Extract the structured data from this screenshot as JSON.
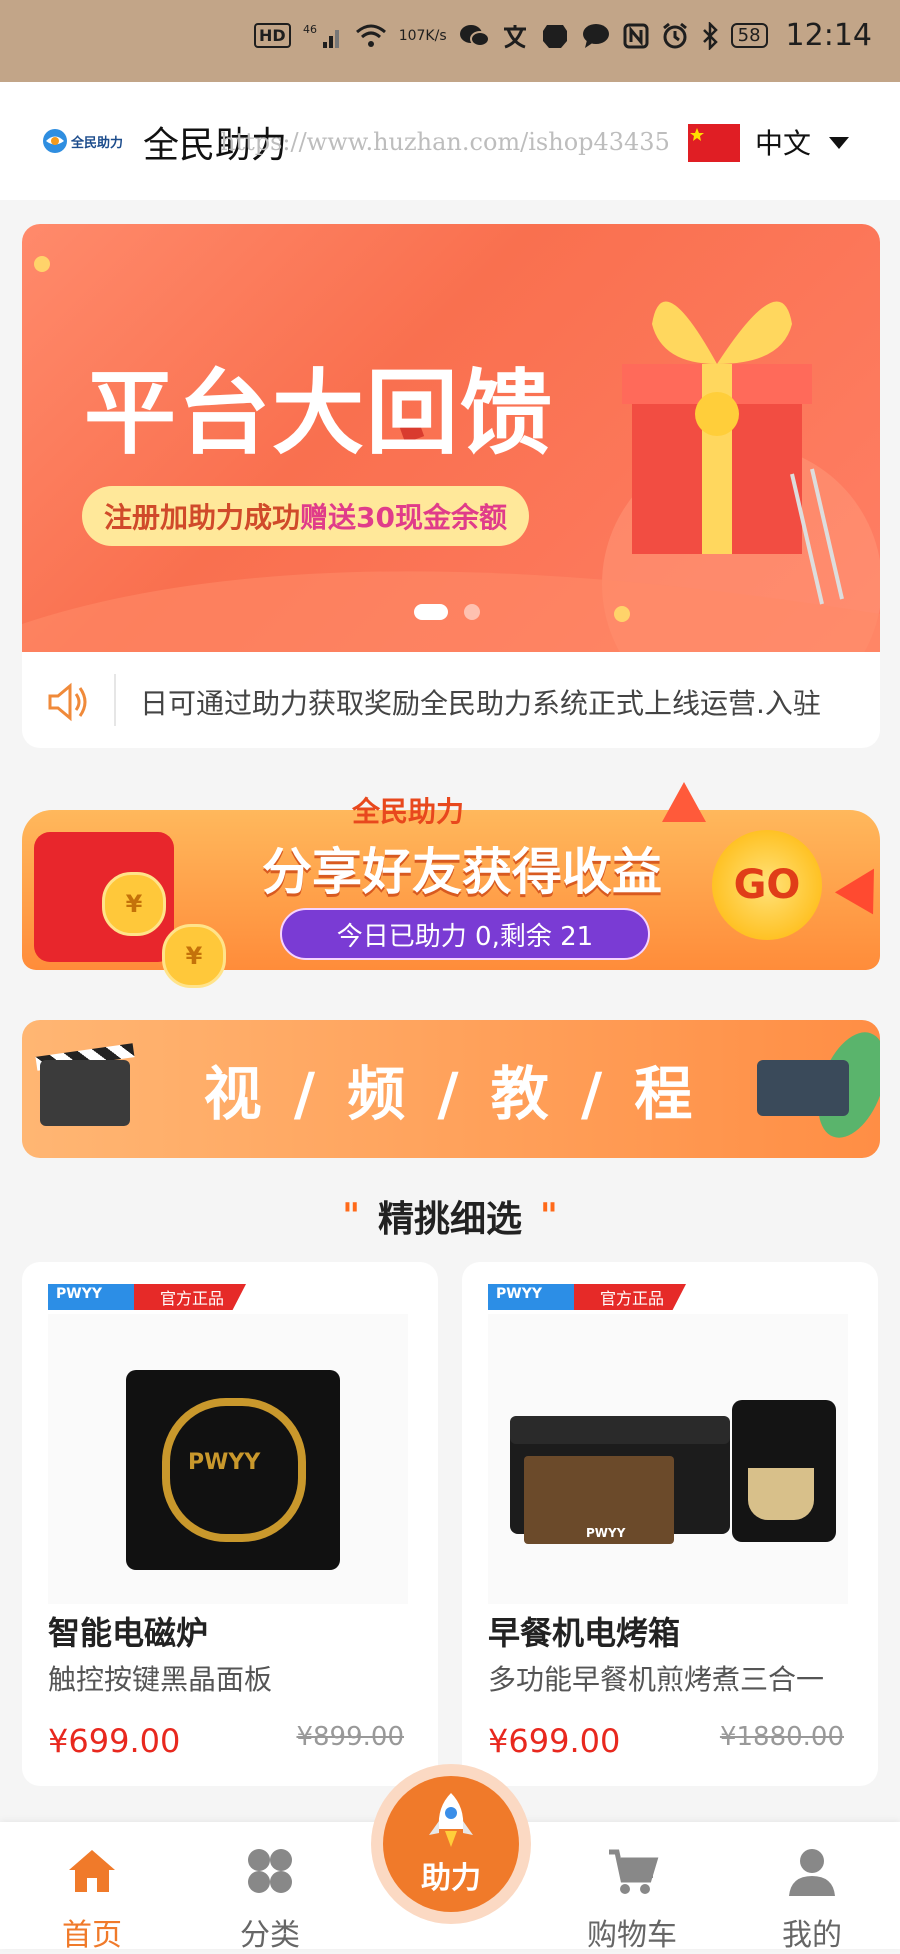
{
  "status_bar": {
    "hd": "HD",
    "signal": "46",
    "net_speed_value": "107",
    "net_speed_unit": "K/s",
    "battery": "58",
    "time": "12:14"
  },
  "header": {
    "logo_text": "全民助力",
    "brand": "全民助力",
    "watermark": "https://www.huzhan.com/ishop43435",
    "language": "中文",
    "flag_icon": "china-flag"
  },
  "banner": {
    "title": "平台大回馈",
    "subtitle_prefix": "注册加助力成功",
    "subtitle_highlight": "赠送30现金余额",
    "active_slide": 1,
    "slide_count": 2
  },
  "notice": {
    "icon": "speaker-icon",
    "text": "日可通过助力获取奖励全民助力系统正式上线运营.入驻"
  },
  "share_banner": {
    "top_label": "全民助力",
    "title": "分享好友获得收益",
    "progress_text": "今日已助力 0,剩余 21",
    "go_label": "GO",
    "coin_symbol": "¥"
  },
  "video_banner": {
    "text": "视 / 频 / 教 / 程"
  },
  "section": {
    "title": "精挑细选",
    "quote_mark": "\""
  },
  "products": [
    {
      "tag_brand": "PWYY",
      "tag_label": "官方正品",
      "image_brand": "PWYY",
      "name": "智能电磁炉",
      "desc": "触控按键黑晶面板",
      "price": "¥699.00",
      "old_price": "¥899.00"
    },
    {
      "tag_brand": "PWYY",
      "tag_label": "官方正品",
      "image_brand": "PWYY",
      "name": "早餐机电烤箱",
      "desc": "多功能早餐机煎烤煮三合一",
      "price": "¥699.00",
      "old_price": "¥1880.00"
    }
  ],
  "nav": {
    "home": "首页",
    "category": "分类",
    "assist": "助力",
    "cart": "购物车",
    "mine": "我的"
  },
  "colors": {
    "accent": "#f07a2a",
    "price": "#e8281e",
    "status_bar": "#c2a588"
  }
}
